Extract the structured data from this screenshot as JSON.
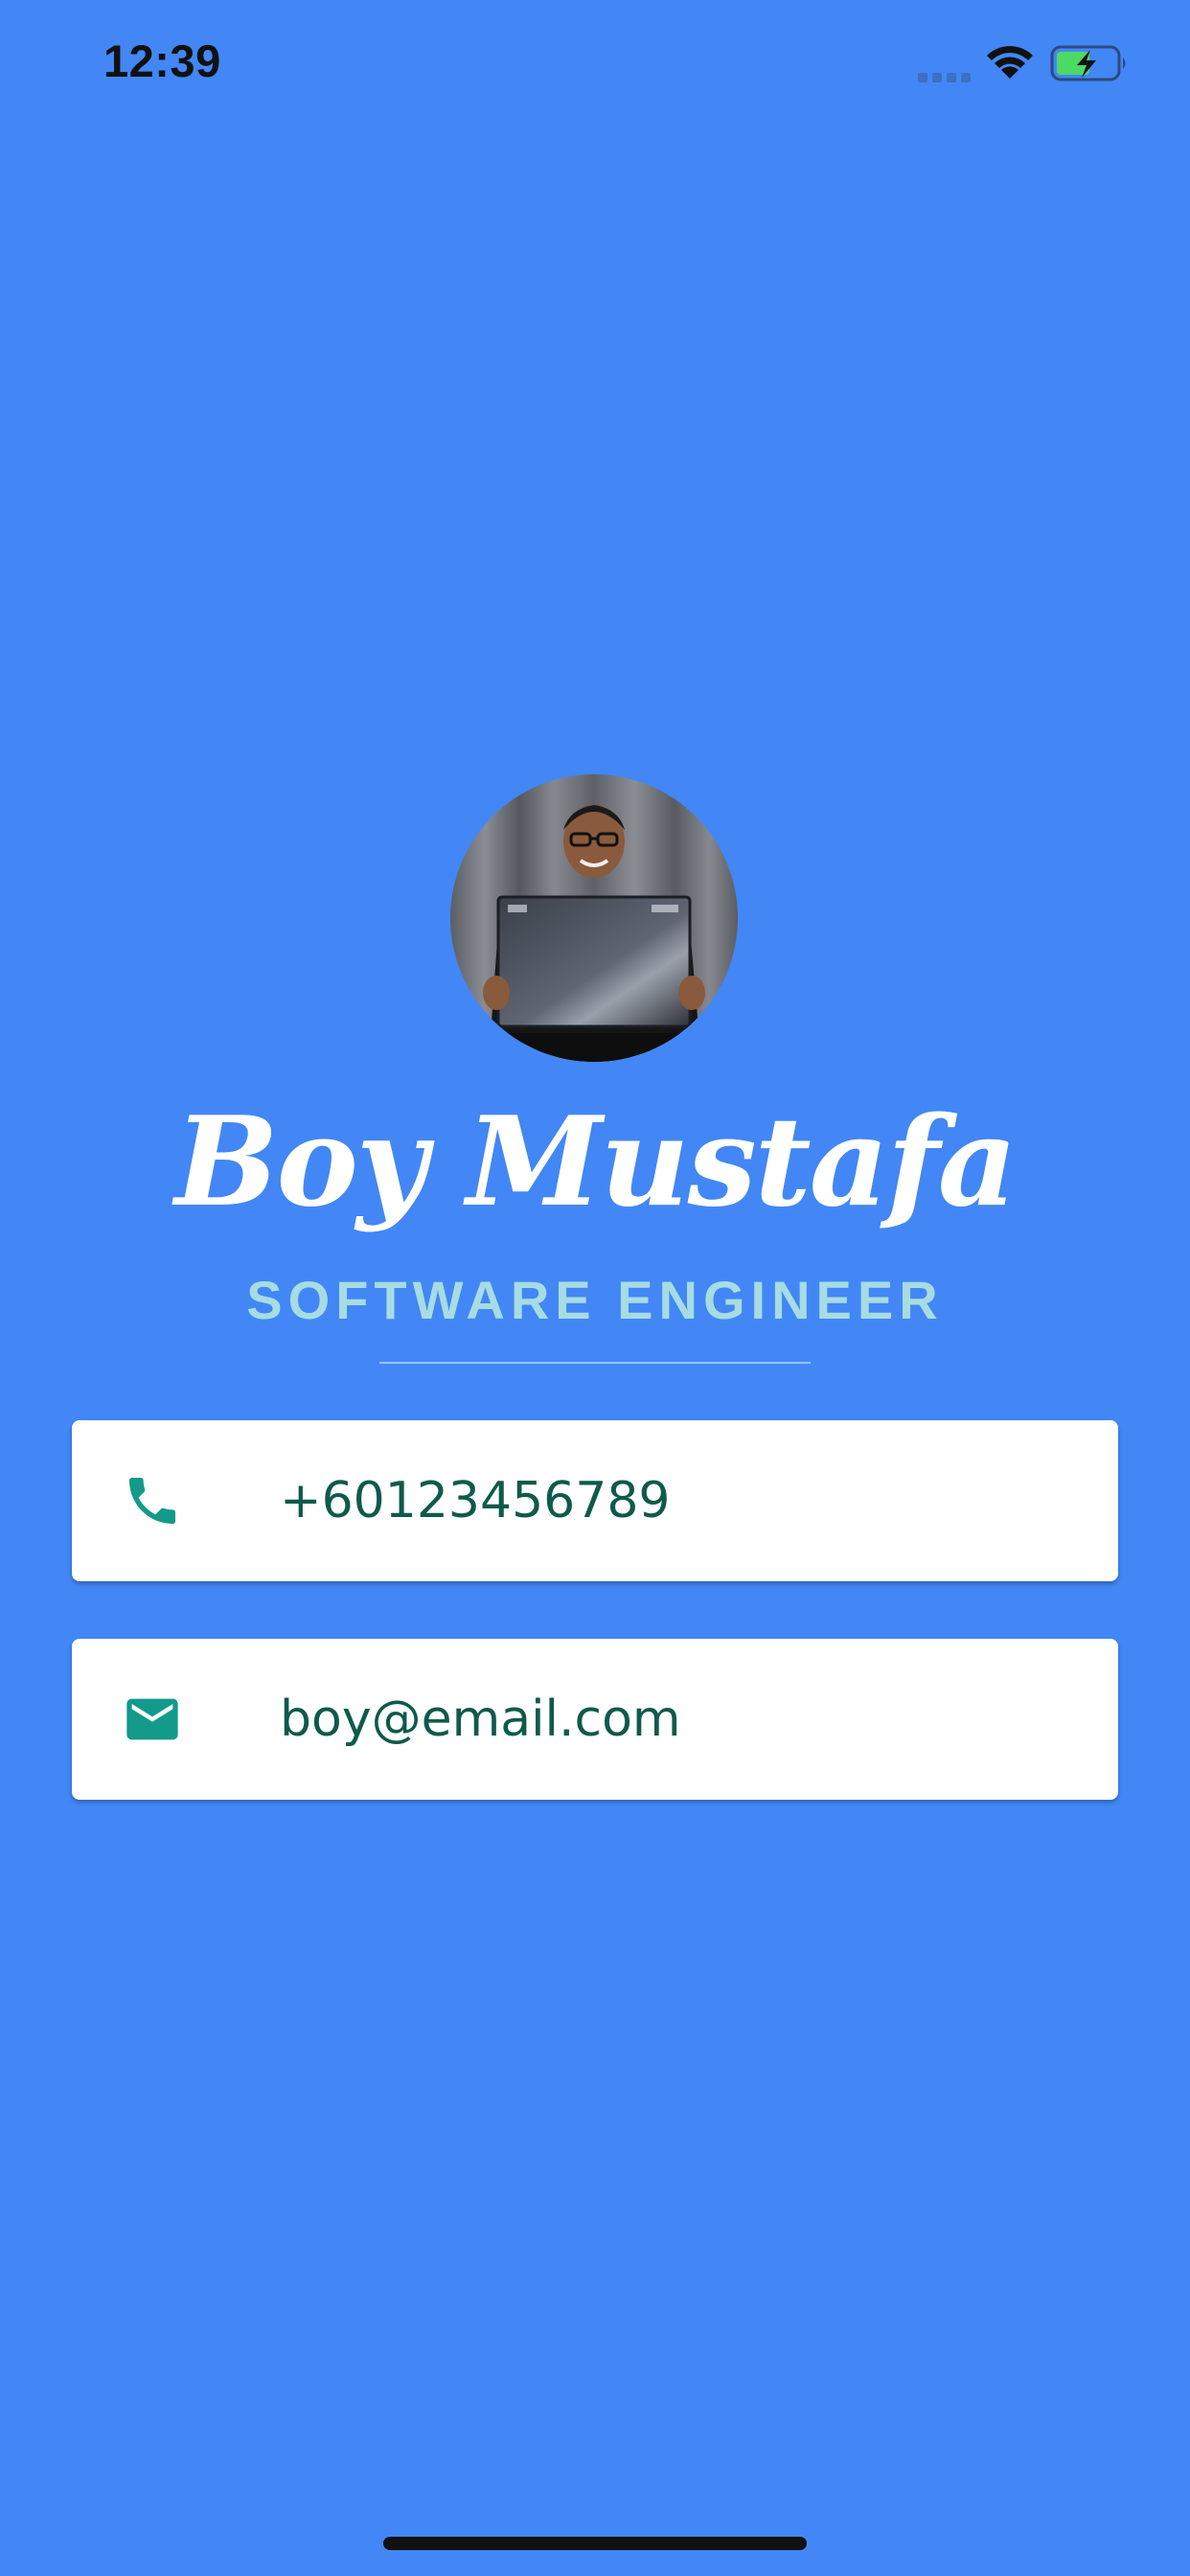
{
  "status_bar": {
    "time": "12:39",
    "signal_icon": "cellular-signal-icon",
    "wifi_icon": "wifi-icon",
    "battery_icon": "battery-charging-icon"
  },
  "profile": {
    "name": "Boy Mustafa",
    "title": "SOFTWARE ENGINEER",
    "avatar_icon": "profile-photo"
  },
  "contacts": {
    "phone": {
      "icon": "phone-icon",
      "value": "+60123456789"
    },
    "email": {
      "icon": "mail-icon",
      "value": "boy@email.com"
    }
  },
  "colors": {
    "background": "#4287F5",
    "name": "#FFFFFF",
    "title": "#A7DCE3",
    "card": "#FFFFFF",
    "card_text": "#0F5A4A",
    "icon": "#139A8A",
    "battery_fill": "#4CD964"
  }
}
